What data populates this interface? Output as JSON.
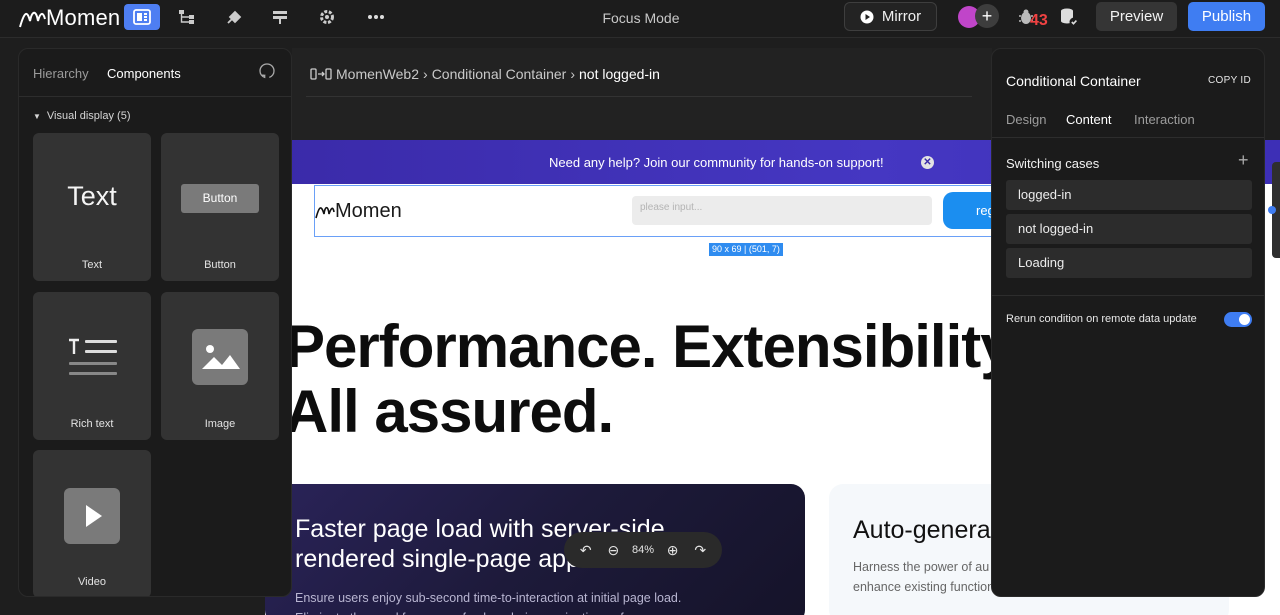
{
  "topbar": {
    "logo_text": "Momen",
    "mode_label": "Focus Mode",
    "mirror_label": "Mirror",
    "plus_label": "+",
    "bug_count": "43",
    "preview_label": "Preview",
    "publish_label": "Publish",
    "accent_color": "#3f7df2"
  },
  "breadcrumb": {
    "items": [
      "MomenWeb2",
      "Conditional Container",
      "not logged-in"
    ]
  },
  "left_panel": {
    "tabs": [
      "Hierarchy",
      "Components"
    ],
    "active_tab": "Components",
    "section_title": "Visual display (5)",
    "components": [
      {
        "label": "Text",
        "preview": "Text"
      },
      {
        "label": "Button",
        "preview": "Button"
      },
      {
        "label": "Rich text",
        "preview": ""
      },
      {
        "label": "Image",
        "preview": ""
      },
      {
        "label": "Video",
        "preview": ""
      }
    ]
  },
  "canvas": {
    "banner_text": "Need any help? Join our community for hands-on support!",
    "site_logo": "Momen",
    "search_placeholder": "please input...",
    "nav_button": "reg",
    "dimension_tag": "90 x 69 | (501, 7)",
    "hero_line1": "Performance. Extensibility. S",
    "hero_line2": "All assured.",
    "card_dark_title": "Faster page load with server-side rendered single-page app",
    "card_dark_text": "Ensure users enjoy sub-second time-to-interaction at initial page load. Eliminate the need for page refreshes during navigation or form",
    "card_light_title": "Auto-genera",
    "card_light_text": "Harness the power of au database that can be eas services to enhance existing functionality."
  },
  "zoom": {
    "level": "84%"
  },
  "right_panel": {
    "title": "Conditional Container",
    "copy_id": "COPY ID",
    "tabs": [
      "Design",
      "Content",
      "Interaction"
    ],
    "active_tab": "Content",
    "section_title": "Switching cases",
    "cases": [
      "logged-in",
      "not logged-in",
      "Loading"
    ],
    "rerun_label": "Rerun condition on remote data update",
    "rerun_enabled": true
  }
}
